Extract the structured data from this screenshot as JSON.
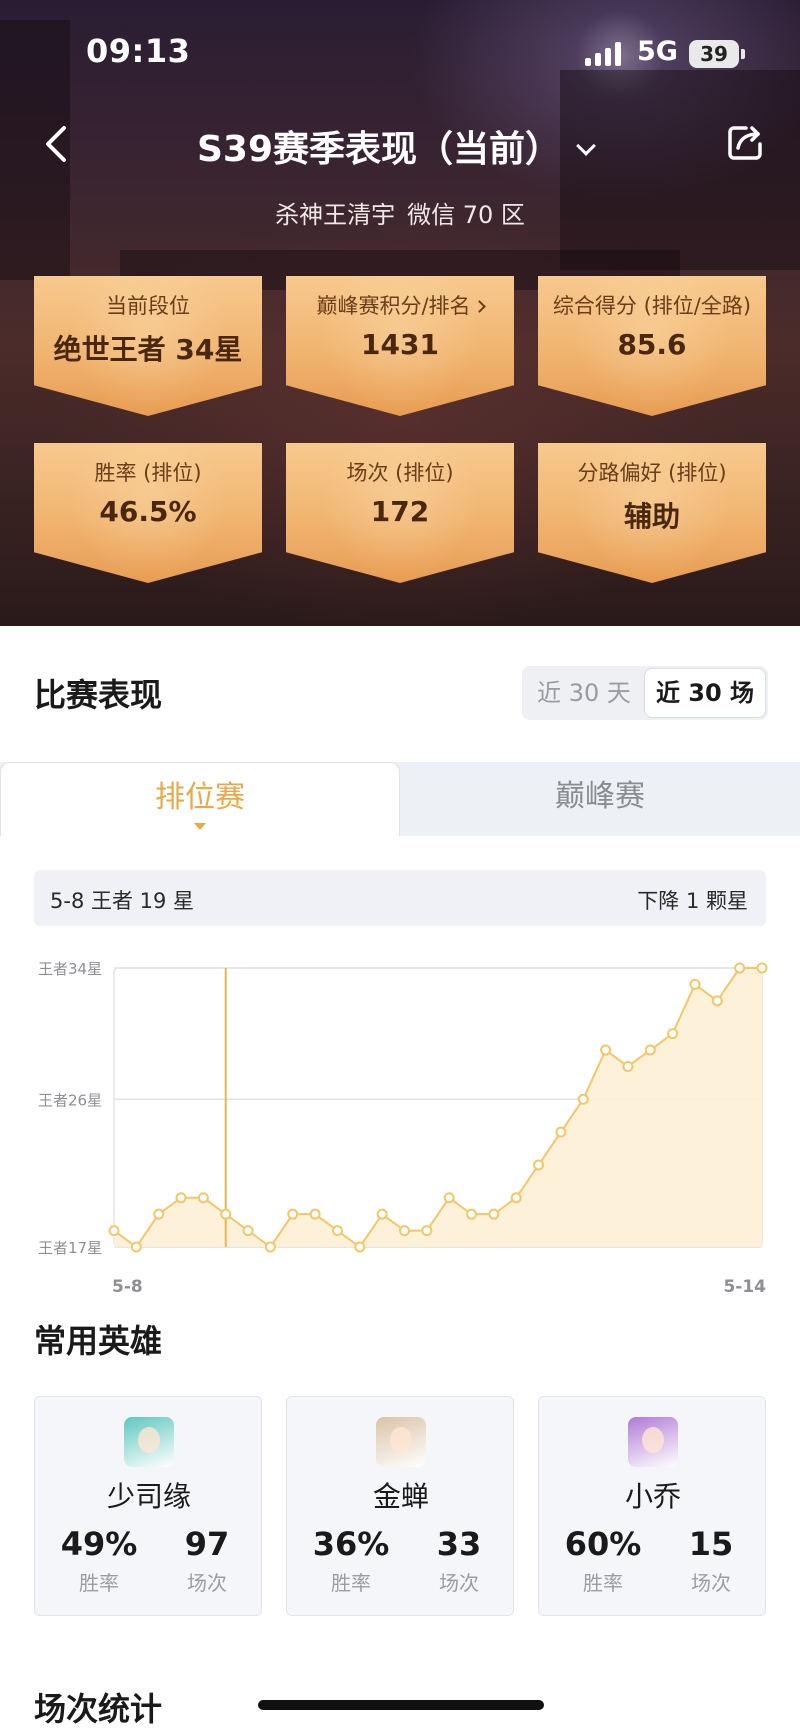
{
  "status_bar": {
    "time": "09:13",
    "network": "5G",
    "battery": "39"
  },
  "nav": {
    "title": "S39赛季表现（当前）"
  },
  "profile": {
    "name": "杀神王清宇",
    "server": "微信 70 区"
  },
  "stat_cards": [
    {
      "label": "当前段位",
      "value": "绝世王者 34星"
    },
    {
      "label": "巅峰赛积分/排名",
      "value": "1431"
    },
    {
      "label": "综合得分 (排位/全路)",
      "value": "85.6"
    },
    {
      "label": "胜率 (排位)",
      "value": "46.5%"
    },
    {
      "label": "场次 (排位)",
      "value": "172"
    },
    {
      "label": "分路偏好 (排位)",
      "value": "辅助"
    }
  ],
  "match_performance": {
    "title": "比赛表现",
    "filters": [
      "近 30 天",
      "近 30 场"
    ],
    "active_filter": 1,
    "tabs": [
      "排位赛",
      "巅峰赛"
    ],
    "active_tab": 0,
    "info_left": "5-8 王者 19 星",
    "info_right": "下降 1 颗星"
  },
  "chart_data": {
    "type": "area",
    "y_tick_labels": [
      "王者34星",
      "王者26星",
      "王者17星"
    ],
    "y_ticks": [
      34,
      26,
      17
    ],
    "ylim": [
      17,
      34
    ],
    "x_start_label": "5-8",
    "x_end_label": "5-14",
    "values": [
      18,
      17,
      19,
      20,
      20,
      19,
      18,
      17,
      19,
      19,
      18,
      17,
      19,
      18,
      18,
      20,
      19,
      19,
      20,
      22,
      24,
      26,
      29,
      28,
      29,
      30,
      33,
      32,
      34,
      34
    ],
    "highlight_index": 5,
    "colors": {
      "line": "#f1c76a",
      "fill": "#fdf0d6",
      "grid": "#e3e3e3"
    }
  },
  "heroes_section": {
    "title": "常用英雄",
    "win_rate_label": "胜率",
    "games_label": "场次",
    "heroes": [
      {
        "name": "少司缘",
        "win_rate": "49%",
        "games": "97",
        "avatar_color": "#5fc7c0"
      },
      {
        "name": "金蝉",
        "win_rate": "36%",
        "games": "33",
        "avatar_color": "#d9c3a5"
      },
      {
        "name": "小乔",
        "win_rate": "60%",
        "games": "15",
        "avatar_color": "#b07ad6"
      }
    ]
  },
  "games_section": {
    "title": "场次统计"
  }
}
